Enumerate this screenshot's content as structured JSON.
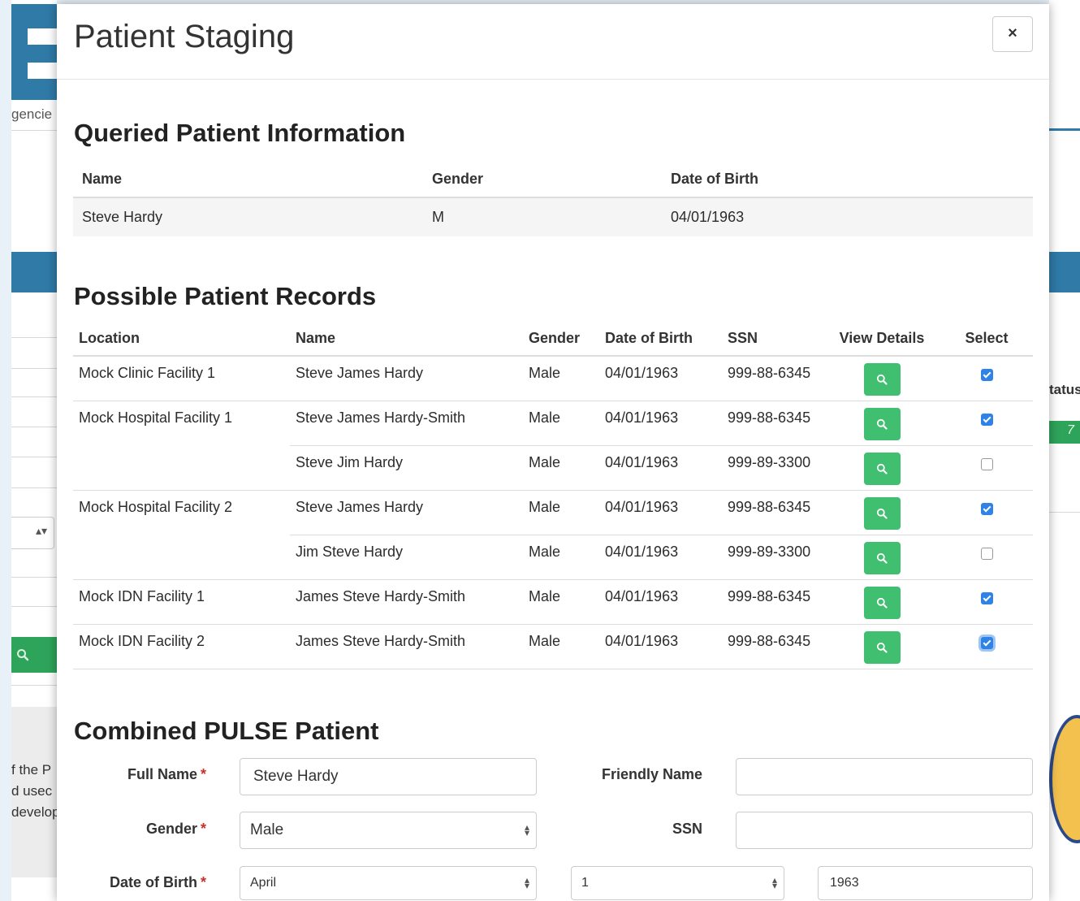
{
  "modal": {
    "title": "Patient Staging",
    "close_symbol": "×"
  },
  "background": {
    "left_snippets": [
      "gencie",
      "f the P",
      "d usec",
      "develop"
    ],
    "right_snippets": [
      "tatus",
      "7"
    ]
  },
  "queried": {
    "heading": "Queried Patient Information",
    "columns": [
      "Name",
      "Gender",
      "Date of Birth"
    ],
    "row": {
      "name": "Steve Hardy",
      "gender": "M",
      "dob": "04/01/1963"
    }
  },
  "records": {
    "heading": "Possible Patient Records",
    "columns": [
      "Location",
      "Name",
      "Gender",
      "Date of Birth",
      "SSN",
      "View Details",
      "Select"
    ],
    "rows": [
      {
        "location": "Mock Clinic Facility 1",
        "name": "Steve James Hardy",
        "gender": "Male",
        "dob": "04/01/1963",
        "ssn": "999-88-6345",
        "selected": true
      },
      {
        "location": "Mock Hospital Facility 1",
        "name": "Steve James Hardy-Smith",
        "gender": "Male",
        "dob": "04/01/1963",
        "ssn": "999-88-6345",
        "selected": true
      },
      {
        "location": "",
        "name": "Steve Jim Hardy",
        "gender": "Male",
        "dob": "04/01/1963",
        "ssn": "999-89-3300",
        "selected": false
      },
      {
        "location": "Mock Hospital Facility 2",
        "name": "Steve James Hardy",
        "gender": "Male",
        "dob": "04/01/1963",
        "ssn": "999-88-6345",
        "selected": true
      },
      {
        "location": "",
        "name": "Jim Steve Hardy",
        "gender": "Male",
        "dob": "04/01/1963",
        "ssn": "999-89-3300",
        "selected": false
      },
      {
        "location": "Mock IDN Facility 1",
        "name": "James Steve Hardy-Smith",
        "gender": "Male",
        "dob": "04/01/1963",
        "ssn": "999-88-6345",
        "selected": true
      },
      {
        "location": "Mock IDN Facility 2",
        "name": "James Steve Hardy-Smith",
        "gender": "Male",
        "dob": "04/01/1963",
        "ssn": "999-88-6345",
        "selected": true
      }
    ]
  },
  "combined": {
    "heading": "Combined PULSE Patient",
    "required_marker": "*",
    "full_name": {
      "label": "Full Name",
      "value": "Steve Hardy"
    },
    "friendly_name": {
      "label": "Friendly Name",
      "value": ""
    },
    "gender": {
      "label": "Gender",
      "value": "Male"
    },
    "ssn": {
      "label": "SSN",
      "value": ""
    },
    "dob": {
      "label": "Date of Birth",
      "month": "April",
      "day": "1",
      "year": "1963"
    }
  },
  "colors": {
    "view_button": "#3fbf6f",
    "checkbox_checked": "#2f83e6",
    "required": "#c9302c",
    "background_brand": "#2f7aa7"
  }
}
